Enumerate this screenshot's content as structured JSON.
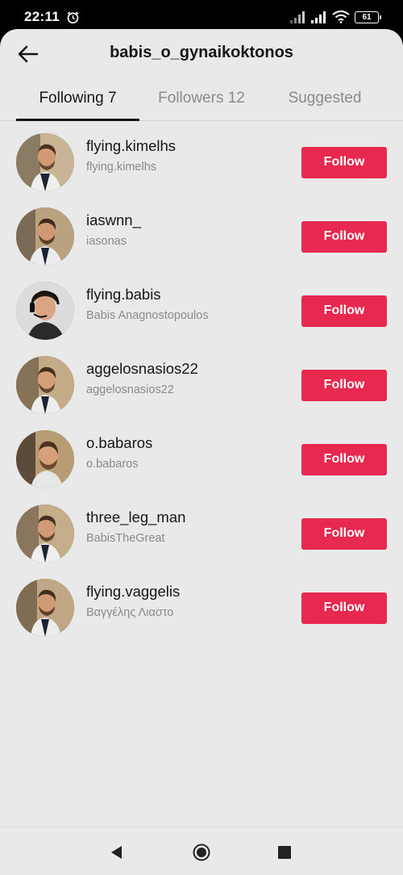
{
  "status_bar": {
    "time": "22:11",
    "battery": "61"
  },
  "header": {
    "title": "babis_o_gynaikoktonos"
  },
  "tabs": [
    {
      "label": "Following 7",
      "active": true
    },
    {
      "label": "Followers 12",
      "active": false
    },
    {
      "label": "Suggested",
      "active": false
    }
  ],
  "users": [
    {
      "username": "flying.kimelhs",
      "nickname": "flying.kimelhs",
      "button": "Follow"
    },
    {
      "username": "iaswnn_",
      "nickname": "iasonas",
      "button": "Follow"
    },
    {
      "username": "flying.babis",
      "nickname": "Babis Anagnostopoulos",
      "button": "Follow"
    },
    {
      "username": "aggelosnasios22",
      "nickname": "aggelosnasios22",
      "button": "Follow"
    },
    {
      "username": "o.babaros",
      "nickname": "o.babaros",
      "button": "Follow"
    },
    {
      "username": "three_leg_man",
      "nickname": "BabisTheGreat",
      "button": "Follow"
    },
    {
      "username": "flying.vaggelis",
      "nickname": "Βαγγέλης Λιαστο",
      "button": "Follow"
    }
  ],
  "colors": {
    "accent": "#e8294f",
    "background": "#e9e9e9",
    "text": "#161616",
    "secondary_text": "#8a8a8a"
  },
  "icons": {
    "back": "arrow-left-icon",
    "alarm": "alarm-icon",
    "nav_back": "triangle-back-icon",
    "nav_home": "circle-home-icon",
    "nav_recents": "square-recents-icon"
  }
}
